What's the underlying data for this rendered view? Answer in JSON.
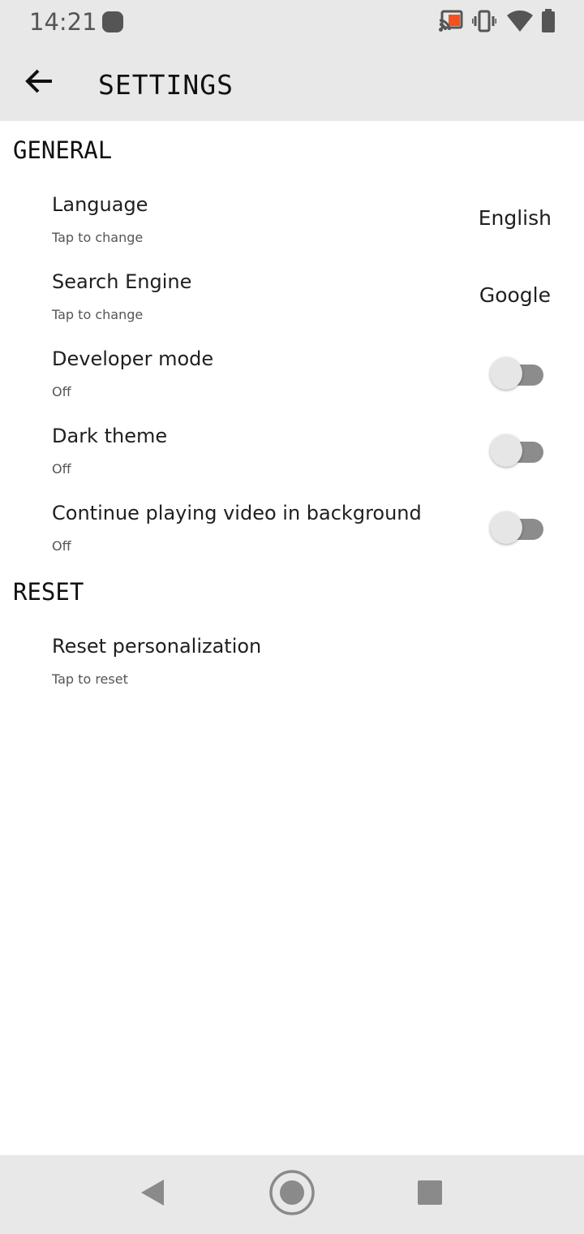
{
  "status_bar": {
    "time": "14:21",
    "icons": [
      "notification-dot-icon",
      "cast-icon",
      "vibrate-icon",
      "wifi-icon",
      "battery-icon"
    ],
    "cast_accent": "#f4511e"
  },
  "app_bar": {
    "title": "SETTINGS",
    "back_icon": "arrow-back-icon"
  },
  "sections": {
    "general": {
      "header": "GENERAL",
      "language": {
        "title": "Language",
        "subtitle": "Tap to change",
        "value": "English"
      },
      "search_engine": {
        "title": "Search Engine",
        "subtitle": "Tap to change",
        "value": "Google"
      },
      "developer_mode": {
        "title": "Developer mode",
        "subtitle": "Off",
        "enabled": false
      },
      "dark_theme": {
        "title": "Dark theme",
        "subtitle": "Off",
        "enabled": false
      },
      "background_video": {
        "title": "Continue playing video in background",
        "subtitle": "Off",
        "enabled": false
      }
    },
    "reset": {
      "header": "RESET",
      "reset_personalization": {
        "title": "Reset personalization",
        "subtitle": "Tap to reset"
      }
    }
  },
  "nav_bar": {
    "icons": [
      "nav-back-icon",
      "nav-home-icon",
      "nav-recents-icon"
    ]
  },
  "colors": {
    "bar_background": "#e8e8e8",
    "switch_track_off": "#8c8c8c",
    "switch_thumb_off": "#e6e6e6"
  }
}
